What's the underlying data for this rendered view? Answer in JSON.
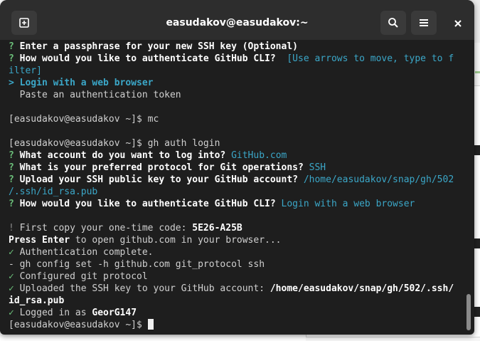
{
  "window": {
    "title": "easudakov@easudakov:~",
    "buttons": [
      "new-tab",
      "search",
      "menu",
      "close"
    ]
  },
  "colors": {
    "terminal_bg": "#1e1e1e",
    "header_bg": "#2d2d2d",
    "prompt_green": "#6cc07a",
    "answer_cyan": "#3ba7c8"
  },
  "terminal": {
    "l1_mark": "?",
    "l1_text": " Enter a passphrase for your new SSH key (Optional)",
    "l2_mark": "?",
    "l2_text": " How would you like to authenticate GitHub CLI?",
    "l2_hint": "  [Use arrows to move, type to f",
    "l3_hint": "ilter]",
    "l4_mark": ">",
    "l4_text": " Login with a web browser",
    "l5_text": "  Paste an authentication token",
    "l6_text": "",
    "l7_text": "[easudakov@easudakov ~]$ mc",
    "l8_text": "",
    "l9_text": "[easudakov@easudakov ~]$ gh auth login",
    "l10_mark": "?",
    "l10_text": " What account do you want to log into?",
    "l10_ans": " GitHub.com",
    "l11_mark": "?",
    "l11_text": " What is your preferred protocol for Git operations?",
    "l11_ans": " SSH",
    "l12_mark": "?",
    "l12_text": " Upload your SSH public key to your GitHub account?",
    "l12_ans": " /home/easudakov/snap/gh/502",
    "l13_ans": "/.ssh/id_rsa.pub",
    "l14_mark": "?",
    "l14_text": " How would you like to authenticate GitHub CLI?",
    "l14_ans": " Login with a web browser",
    "l15_text": "",
    "l16_mark": "!",
    "l16_text": " First copy your one-time code: ",
    "l16_code": "5E26-A25B",
    "l17_bold": "Press Enter",
    "l17_text": " to open github.com in your browser...",
    "l18_mark": "✓",
    "l18_text": " Authentication complete.",
    "l19_text": "- gh config set -h github.com git_protocol ssh",
    "l20_mark": "✓",
    "l20_text": " Configured git protocol",
    "l21_mark": "✓",
    "l21_text": " Uploaded the SSH key to your GitHub account: ",
    "l21_path": "/home/easudakov/snap/gh/502/.ssh/",
    "l22_path": "id_rsa.pub",
    "l23_mark": "✓",
    "l23_text": " Logged in as ",
    "l23_user": "GeorG147",
    "l24_text": "[easudakov@easudakov ~]$ "
  }
}
